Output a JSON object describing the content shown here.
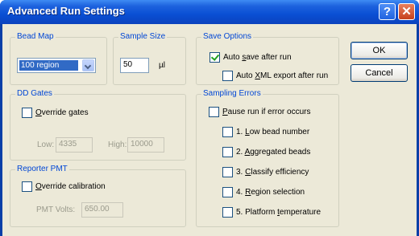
{
  "window": {
    "title": "Advanced Run Settings",
    "help_glyph": "?",
    "close_glyph": "✕"
  },
  "bead_map": {
    "legend": "Bead Map",
    "selected": "100 region"
  },
  "sample_size": {
    "legend": "Sample Size",
    "value": "50",
    "unit": "µl"
  },
  "save_options": {
    "legend": "Save Options",
    "auto_save": {
      "pre": "Auto ",
      "u": "s",
      "post": "ave after run",
      "checked": true
    },
    "auto_xml": {
      "pre": "Auto ",
      "u": "X",
      "post": "ML export after run",
      "checked": false
    }
  },
  "dd_gates": {
    "legend": "DD Gates",
    "override": {
      "pre": "",
      "u": "O",
      "post": "verride gates",
      "checked": false
    },
    "low_label": "Low:",
    "low_value": "4335",
    "high_label": "High:",
    "high_value": "10000"
  },
  "sampling_errors": {
    "legend": "Sampling Errors",
    "pause": {
      "pre": "",
      "u": "P",
      "post": "ause run if error occurs",
      "checked": false
    },
    "items": [
      {
        "pre": "1. ",
        "u": "L",
        "post": "ow bead number",
        "checked": false
      },
      {
        "pre": "2. ",
        "u": "A",
        "post": "ggregated beads",
        "checked": false
      },
      {
        "pre": "3. ",
        "u": "C",
        "post": "lassify efficiency",
        "checked": false
      },
      {
        "pre": "4. ",
        "u": "R",
        "post": "egion selection",
        "checked": false
      },
      {
        "pre": "5. Platform ",
        "u": "t",
        "post": "emperature",
        "checked": false
      }
    ]
  },
  "reporter_pmt": {
    "legend": "Reporter PMT",
    "override": {
      "pre": "",
      "u": "O",
      "post": "verride calibration",
      "checked": false
    },
    "volts_label": "PMT Volts:",
    "volts_value": "650.00"
  },
  "buttons": {
    "ok": "OK",
    "cancel": "Cancel"
  }
}
